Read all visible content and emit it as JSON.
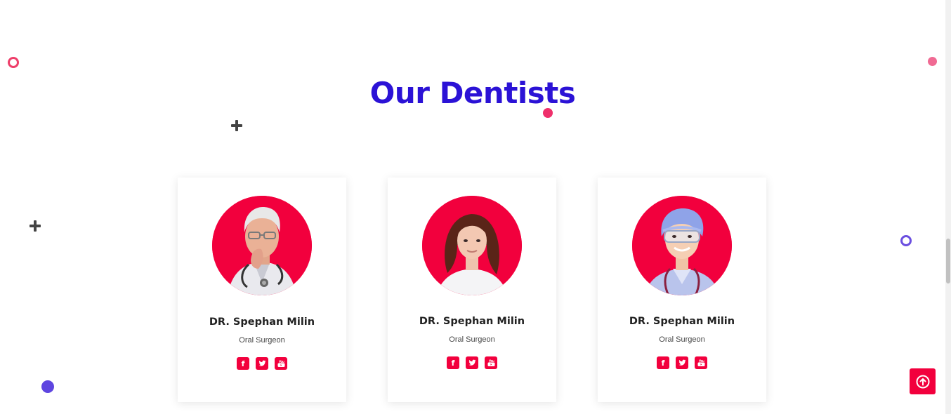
{
  "section": {
    "title": "Our Dentists"
  },
  "dentists": [
    {
      "name": "DR. Spephan Milin",
      "role": "Oral Surgeon"
    },
    {
      "name": "DR. Spephan Milin",
      "role": "Oral Surgeon"
    },
    {
      "name": "DR. Spephan Milin",
      "role": "Oral Surgeon"
    }
  ],
  "social_icons": [
    "facebook-icon",
    "twitter-icon",
    "youtube-icon"
  ],
  "colors": {
    "title": "#2b12d6",
    "accent": "#f2003d",
    "decor_pink": "#ee3e6a",
    "decor_violet": "#5e45e0"
  },
  "back_to_top_icon": "arrow-up-circle-icon"
}
